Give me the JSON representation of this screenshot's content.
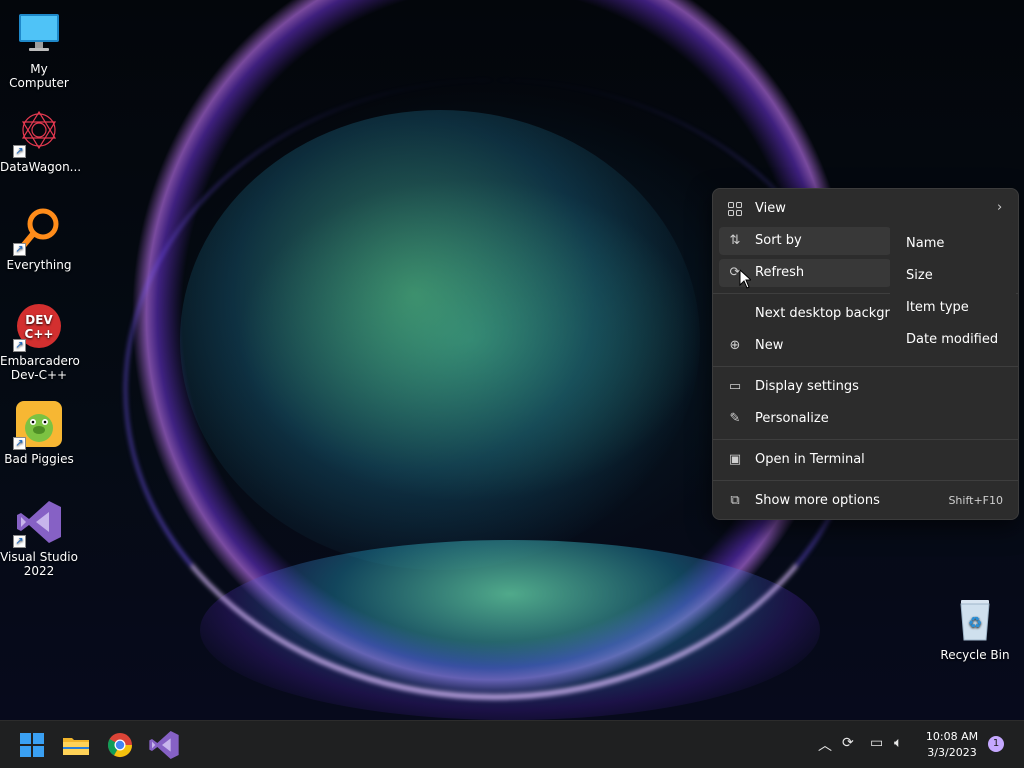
{
  "desktop_icons": [
    {
      "label": "My Computer",
      "icon": "monitor-icon"
    },
    {
      "label": "DataWagon...",
      "icon": "datawagon-icon"
    },
    {
      "label": "Everything",
      "icon": "magnifier-icon"
    },
    {
      "label": "Embarcadero Dev-C++",
      "icon": "devcpp-icon",
      "badge": "DEV C++"
    },
    {
      "label": "Bad Piggies",
      "icon": "bad-piggies-icon"
    },
    {
      "label": "Visual Studio 2022",
      "icon": "visual-studio-icon"
    },
    {
      "label": "Recycle Bin",
      "icon": "recycle-bin-icon"
    }
  ],
  "context_menu": {
    "items": [
      {
        "label": "View",
        "icon": "grid-icon",
        "has_submenu": true
      },
      {
        "label": "Sort by",
        "icon": "sort-icon",
        "has_submenu": true
      },
      {
        "label": "Refresh",
        "icon": "refresh-icon"
      },
      {
        "label": "Next desktop backgro",
        "icon": ""
      },
      {
        "label": "New",
        "icon": "plus-circle-icon",
        "has_submenu": true
      },
      {
        "label": "Display settings",
        "icon": "display-icon"
      },
      {
        "label": "Personalize",
        "icon": "pen-icon"
      },
      {
        "label": "Open in Terminal",
        "icon": "terminal-icon"
      },
      {
        "label": "Show more options",
        "icon": "expand-icon",
        "shortcut": "Shift+F10"
      }
    ],
    "submenu": [
      "Name",
      "Size",
      "Item type",
      "Date modified"
    ]
  },
  "taskbar": {
    "pinned": [
      "start-icon",
      "file-explorer-icon",
      "chrome-icon",
      "visual-studio-icon"
    ],
    "tray": [
      "chevron-up-icon",
      "sync-alert-icon",
      "network-icon",
      "volume-icon"
    ],
    "time": "10:08 AM",
    "date": "3/3/2023",
    "notifications": "1"
  },
  "colors": {
    "menu_bg": "#2c2c2c",
    "taskbar_bg": "#1f2021",
    "accent": "#0078d4",
    "notif_badge": "#c5a8ff"
  }
}
